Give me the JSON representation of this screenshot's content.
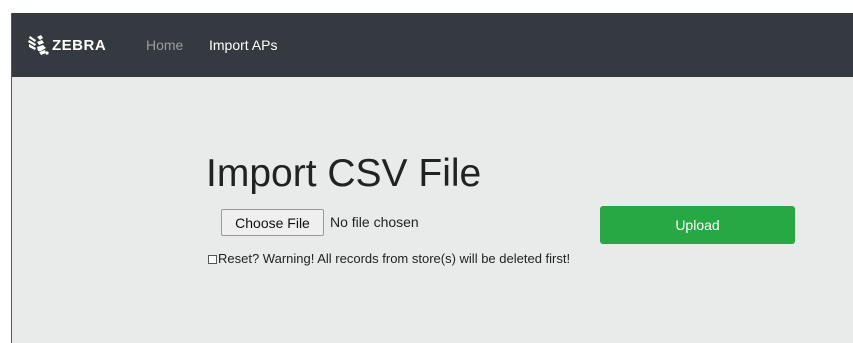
{
  "navbar": {
    "brand": "ZEBRA",
    "brand_icon": "zebra-head-logo",
    "links": [
      {
        "label": "Home",
        "color": "#9a9da1"
      },
      {
        "label": "Import APs",
        "color": "#ffffff"
      }
    ],
    "background": "#343a40"
  },
  "main": {
    "title": "Import CSV File",
    "file_input": {
      "button_label": "Choose File",
      "status": "No file chosen"
    },
    "upload_button": {
      "label": "Upload",
      "color": "#28a745"
    },
    "reset": {
      "checked": false,
      "label": "Reset? Warning! All records from store(s) will be deleted first!"
    }
  }
}
